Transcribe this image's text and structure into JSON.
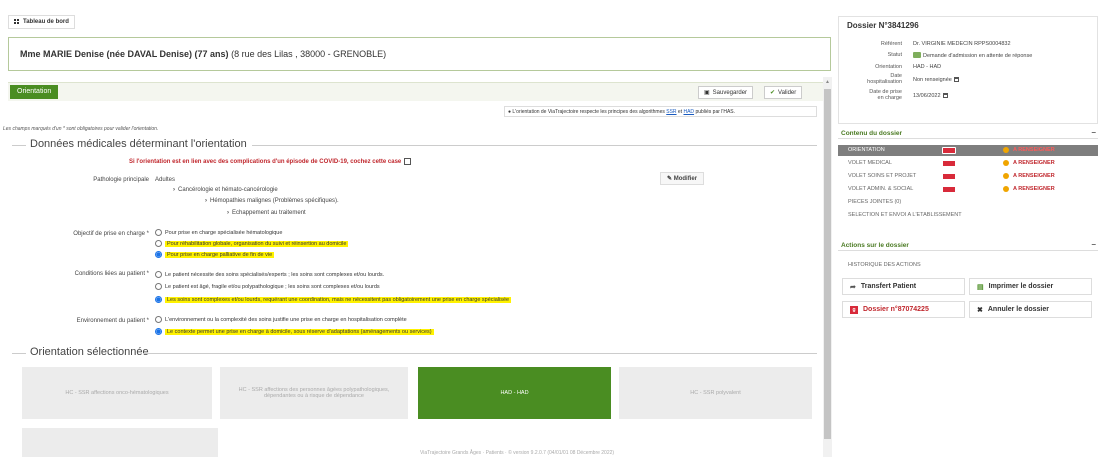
{
  "breadcrumb": {
    "label": "Tableau de bord"
  },
  "patient": {
    "name": "Mme MARIE Denise (née DAVAL Denise) (77 ans)",
    "address": "(8 rue des Lilas , 38000 - GRENOBLE)"
  },
  "orientation": {
    "tab_label": "Orientation",
    "save_label": "Sauvegarder",
    "validate_label": "Valider",
    "algo_note_prefix": "L'orientation de ViaTrajectoire respecte les principes des algorithmes",
    "algo_link_ssr": "SSR",
    "algo_and": "et",
    "algo_link_had": "HAD",
    "algo_note_suffix": "publiés par l'HAS.",
    "mandatory_note": "Les champs marqués d'un * sont obligatoires pour valider l'orientation."
  },
  "medical": {
    "section_title": "Données médicales déterminant l'orientation",
    "covid_text": "Si l'orientation est en lien avec des complications d'un épisode de COVID-19, cochez cette case",
    "pathology_label": "Pathologie principale",
    "pathology_root": "Adultes",
    "pathology_level1": "Cancérologie et hémato-cancérologie",
    "pathology_level2": "Hémopathies malignes (Problèmes spécifiques).",
    "pathology_level3": "Echappement au traitement",
    "modify_label": "Modifier",
    "objective_label": "Objectif de prise en charge *",
    "objective_options": [
      {
        "text": "Pour prise en charge spécialisée hématologique"
      },
      {
        "text": "Pour réhabilitation globale, organisation du suivi et réinsertion au domicile"
      },
      {
        "text": "Pour prise en charge palliative de fin de vie"
      }
    ],
    "conditions_label": "Conditions liées au patient *",
    "conditions_options": [
      {
        "text": "Le patient nécessite des soins spécialisés/experts ; les soins sont complexes et/ou lourds."
      },
      {
        "text": "Le patient est âgé, fragile et/ou polypathologique ; les soins sont complexes et/ou lourds"
      },
      {
        "text": "Les soins sont complexes et/ou lourds, requérant une coordination, mais ne nécessitent pas obligatoirement une prise en charge spécialisée"
      }
    ],
    "environment_label": "Environnement du patient *",
    "environment_options": [
      {
        "text": "L'environnement ou la complexité des soins justifie une prise en charge en hospitalisation complète"
      },
      {
        "text": "Le contexte permet une prise en charge à domicile, sous réserve d'adaptations (aménagements ou services)"
      }
    ]
  },
  "selected_orientation": {
    "section_title": "Orientation sélectionnée",
    "cards": [
      {
        "label": "HC - SSR affections onco-hématologiques"
      },
      {
        "label": "HC - SSR affections des personnes âgées polypathologiques, dépendantes ou à risque de dépendance"
      },
      {
        "label": "HAD - HAD"
      },
      {
        "label": "HC - SSR polyvalent"
      }
    ],
    "footer": "ViaTrajectoire Grands Åges · Patients · © version 9.2.0.7 (04/01/01 08 Décembre 2022)"
  },
  "dossier": {
    "title": "Dossier N°3841296",
    "referent_label": "Référent",
    "referent_value": "Dr. VIRGINIE MEDECIN RPPS0004832",
    "status_label": "Statut",
    "status_value": "Demande d'admission en attente de réponse",
    "orientation_label": "Orientation",
    "orientation_value": "HAD - HAD",
    "hosp_label_1": "Date",
    "hosp_label_2": "hospitalisation",
    "hosp_value": "Non renseignée",
    "care_label_1": "Date de prise",
    "care_label_2": "en charge",
    "care_value": "13/06/2022"
  },
  "contents": {
    "title": "Contenu du dossier",
    "items": [
      {
        "label": "ORIENTATION",
        "status": "A RENSEIGNER"
      },
      {
        "label": "VOLET MEDICAL",
        "status": "A RENSEIGNER"
      },
      {
        "label": "VOLET SOINS ET PROJET",
        "status": "A RENSEIGNER"
      },
      {
        "label": "VOLET ADMIN. & SOCIAL",
        "status": "A RENSEIGNER"
      },
      {
        "label": "PIECES JOINTES (0)",
        "status": ""
      },
      {
        "label": "SELECTION ET ENVOI A L'ETABLISSEMENT",
        "status": ""
      }
    ]
  },
  "actions": {
    "title": "Actions sur le dossier",
    "history_label": "HISTORIQUE DES ACTIONS",
    "transfer_label": "Transfert Patient",
    "print_label": "Imprimer le dossier",
    "linked_dossier_label": "Dossier n°87074225",
    "cancel_label": "Annuler le dossier"
  },
  "colors": {
    "accent_green": "#4a8d22",
    "highlight": "#fff200",
    "alert_red": "#c0272d"
  }
}
